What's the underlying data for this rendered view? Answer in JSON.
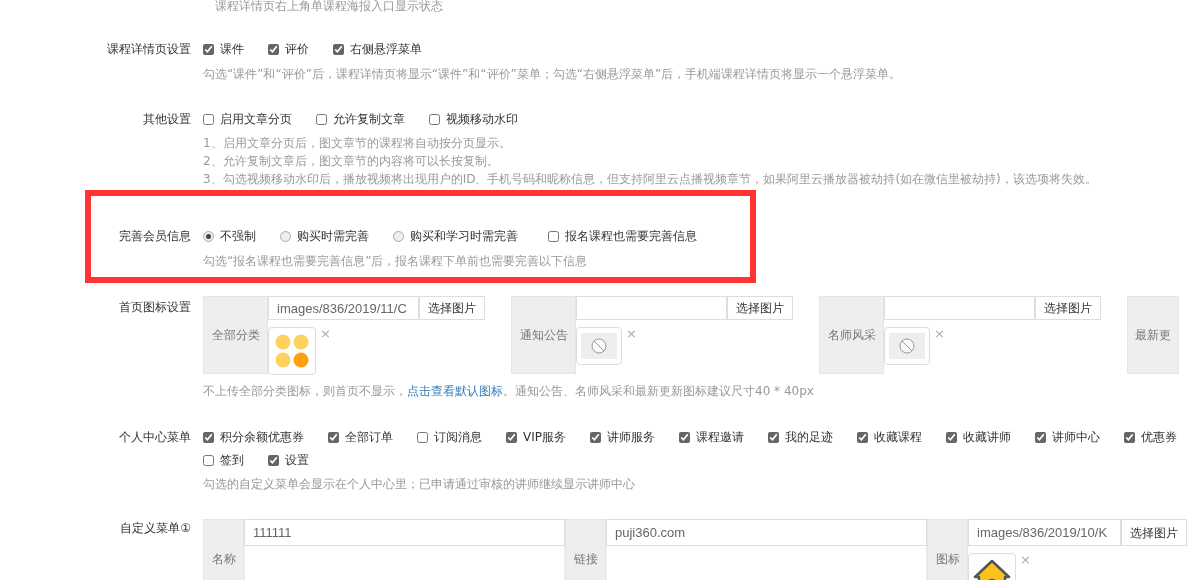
{
  "top_note": "课程详情页右上角单课程海报入口显示状态",
  "detail_settings": {
    "label": "课程详情页设置",
    "options": [
      {
        "label": "课件",
        "checked": true
      },
      {
        "label": "评价",
        "checked": true
      },
      {
        "label": "右侧悬浮菜单",
        "checked": true
      }
    ],
    "help": [
      "勾选“课件”和“评价”后，课程详情页将显示“课件”和“评价”菜单；勾选“右侧悬浮菜单”后，手机端课程详情页将显示一个悬浮菜单。"
    ]
  },
  "other_settings": {
    "label": "其他设置",
    "options": [
      {
        "label": "启用文章分页",
        "checked": false
      },
      {
        "label": "允许复制文章",
        "checked": false
      },
      {
        "label": "视频移动水印",
        "checked": false
      }
    ],
    "help": [
      "1、启用文章分页后，图文章节的课程将自动按分页显示。",
      "2、允许复制文章后，图文章节的内容将可以长按复制。",
      "3、勾选视频移动水印后，播放视频将出现用户的ID、手机号码和昵称信息，但支持阿里云点播视频章节，如果阿里云播放器被劫持(如在微信里被劫持)，该选项将失效。"
    ]
  },
  "member_info": {
    "label": "完善会员信息",
    "highlighted": true,
    "options": [
      {
        "label": "不强制",
        "selected": true
      },
      {
        "label": "购买时需完善",
        "selected": false
      },
      {
        "label": "购买和学习时需完善",
        "selected": false
      }
    ],
    "extra_option": {
      "label": "报名课程也需要完善信息",
      "checked": false
    },
    "help": "勾选“报名课程也需要完善信息”后，报名课程下单前也需要完善以下信息"
  },
  "home_icons": {
    "label": "首页图标设置",
    "groups": [
      {
        "label": "全部分类",
        "value": "images/836/2019/11/C",
        "button": "选择图片",
        "kind": "icon",
        "remove": "×"
      },
      {
        "label": "通知公告",
        "button": "选择图片",
        "kind": "empty",
        "remove": "×"
      },
      {
        "label": "名师风采",
        "button": "选择图片",
        "kind": "empty",
        "remove": "×"
      },
      {
        "label": "最新更",
        "kind": "cut"
      }
    ],
    "help_before": "不上传全部分类图标，则首页不显示，",
    "help_link": "点击查看默认图标",
    "help_after": "。通知公告、名师风采和最新更新图标建议尺寸40 * 40px"
  },
  "personal_menu": {
    "label": "个人中心菜单",
    "lines": [
      {
        "items": [
          {
            "label": "积分余额优惠券",
            "checked": true
          },
          {
            "label": "全部订单",
            "checked": true
          },
          {
            "label": "订阅消息",
            "checked": false
          },
          {
            "label": "VIP服务",
            "checked": true
          },
          {
            "label": "讲师服务",
            "checked": true
          },
          {
            "label": "课程邀请",
            "checked": true
          },
          {
            "label": "我的足迹",
            "checked": true
          },
          {
            "label": "收藏课程",
            "checked": true
          },
          {
            "label": "收藏讲师",
            "checked": true
          },
          {
            "label": "讲师中心",
            "checked": true
          },
          {
            "label": "优惠券",
            "checked": true
          }
        ]
      },
      {
        "items": [
          {
            "label": "签到",
            "checked": false
          },
          {
            "label": "设置",
            "checked": true
          }
        ]
      }
    ],
    "help": "勾选的自定义菜单会显示在个人中心里；已申请通过审核的讲师继续显示讲师中心"
  },
  "custom_menu": {
    "label": "自定义菜单①",
    "groups": [
      {
        "kind": "text",
        "label": "名称",
        "value": "111111"
      },
      {
        "kind": "text",
        "label": "链接",
        "value": "puji360.com"
      },
      {
        "kind": "image",
        "label": "图标",
        "value": "images/836/2019/10/K",
        "button": "选择图片",
        "remove": "×"
      }
    ]
  }
}
